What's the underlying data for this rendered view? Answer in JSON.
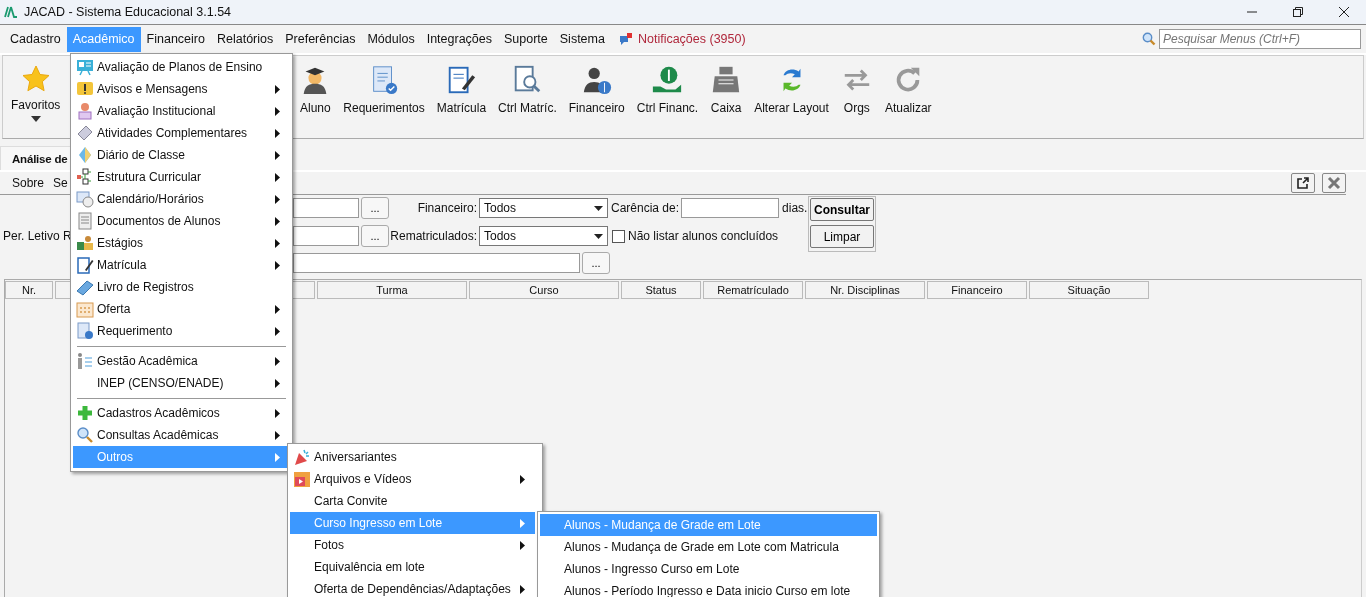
{
  "window": {
    "title": "JACAD - Sistema Educacional 3.1.54"
  },
  "menu_bar": {
    "items": [
      {
        "label": "Cadastro",
        "selected": false
      },
      {
        "label": "Acadêmico",
        "selected": true
      },
      {
        "label": "Financeiro",
        "selected": false
      },
      {
        "label": "Relatórios",
        "selected": false
      },
      {
        "label": "Preferências",
        "selected": false
      },
      {
        "label": "Módulos",
        "selected": false
      },
      {
        "label": "Integrações",
        "selected": false
      },
      {
        "label": "Suporte",
        "selected": false
      },
      {
        "label": "Sistema",
        "selected": false
      }
    ],
    "notifications": "Notificações (3950)",
    "search": {
      "placeholder": "Pesquisar Menus (Ctrl+F)"
    }
  },
  "toolbar": {
    "favorites": "Favoritos",
    "buttons": [
      "Aluno",
      "Requerimentos",
      "Matrícula",
      "Ctrl Matríc.",
      "Financeiro",
      "Ctrl Financ.",
      "Caixa",
      "Alterar Layout",
      "Orgs",
      "Atualizar"
    ]
  },
  "tabs": [
    {
      "label": "Análise de",
      "selected": true
    }
  ],
  "tab_menu": [
    "Sobre",
    "Se"
  ],
  "form": {
    "left_labels": [
      "Per. Letivo R"
    ],
    "browse_buttons": [
      "...",
      "...",
      "..."
    ],
    "financeiro": {
      "label": "Financeiro:",
      "value": "Todos"
    },
    "rematriculados": {
      "label": "Rematriculados:",
      "value": "Todos"
    },
    "carencia": {
      "label": "Carência de:",
      "unit": "dias."
    },
    "exclude_completed": {
      "label": "Não listar alunos concluídos",
      "checked": false
    },
    "buttons": [
      "Consultar",
      "Limpar"
    ]
  },
  "table": {
    "columns": [
      "Nr.",
      "Turma",
      "Curso",
      "Status",
      "Rematrículado",
      "Nr. Disciplinas",
      "Financeiro",
      "Situação"
    ]
  },
  "dropdown": {
    "items": [
      {
        "kind": "item",
        "label": "Avaliação de Planos de Ensino",
        "submenu": false,
        "selected": false
      },
      {
        "kind": "item",
        "label": "Avisos e Mensagens",
        "submenu": true,
        "selected": false
      },
      {
        "kind": "item",
        "label": "Avaliação Institucional",
        "submenu": true,
        "selected": false
      },
      {
        "kind": "item",
        "label": "Atividades Complementares",
        "submenu": true,
        "selected": false
      },
      {
        "kind": "item",
        "label": "Diário de Classe",
        "submenu": true,
        "selected": false
      },
      {
        "kind": "item",
        "label": "Estrutura Curricular",
        "submenu": true,
        "selected": false
      },
      {
        "kind": "item",
        "label": "Calendário/Horários",
        "submenu": true,
        "selected": false
      },
      {
        "kind": "item",
        "label": "Documentos de Alunos",
        "submenu": true,
        "selected": false
      },
      {
        "kind": "item",
        "label": "Estágios",
        "submenu": true,
        "selected": false
      },
      {
        "kind": "item",
        "label": "Matrícula",
        "submenu": true,
        "selected": false
      },
      {
        "kind": "item",
        "label": "Livro de Registros",
        "submenu": false,
        "selected": false
      },
      {
        "kind": "item",
        "label": "Oferta",
        "submenu": true,
        "selected": false
      },
      {
        "kind": "item",
        "label": "Requerimento",
        "submenu": true,
        "selected": false
      },
      {
        "kind": "separator"
      },
      {
        "kind": "item",
        "label": "Gestão Acadêmica",
        "submenu": true,
        "selected": false
      },
      {
        "kind": "item",
        "label": "INEP (CENSO/ENADE)",
        "submenu": true,
        "selected": false
      },
      {
        "kind": "separator"
      },
      {
        "kind": "item",
        "label": "Cadastros Acadêmicos",
        "submenu": true,
        "selected": false
      },
      {
        "kind": "item",
        "label": "Consultas Acadêmicas",
        "submenu": true,
        "selected": false
      },
      {
        "kind": "item",
        "label": "Outros",
        "submenu": true,
        "selected": true
      }
    ]
  },
  "submenu_outros": {
    "items": [
      {
        "label": "Aniversariantes",
        "submenu": false,
        "selected": false
      },
      {
        "label": "Arquivos e Vídeos",
        "submenu": true,
        "selected": false
      },
      {
        "label": "Carta Convite",
        "submenu": false,
        "selected": false
      },
      {
        "label": "Curso Ingresso em Lote",
        "submenu": true,
        "selected": true
      },
      {
        "label": "Fotos",
        "submenu": true,
        "selected": false
      },
      {
        "label": "Equivalência em lote",
        "submenu": false,
        "selected": false
      },
      {
        "label": "Oferta de Dependências/Adaptações",
        "submenu": true,
        "selected": false
      }
    ]
  },
  "submenu_curso_ingresso": {
    "items": [
      {
        "label": "Alunos - Mudança de Grade em Lote",
        "selected": true
      },
      {
        "label": "Alunos - Mudança de Grade em Lote com Matricula",
        "selected": false
      },
      {
        "label": "Alunos - Ingresso Curso em Lote",
        "selected": false
      },
      {
        "label": "Alunos - Período Ingresso e Data inicio Curso em lote",
        "selected": false
      }
    ]
  }
}
